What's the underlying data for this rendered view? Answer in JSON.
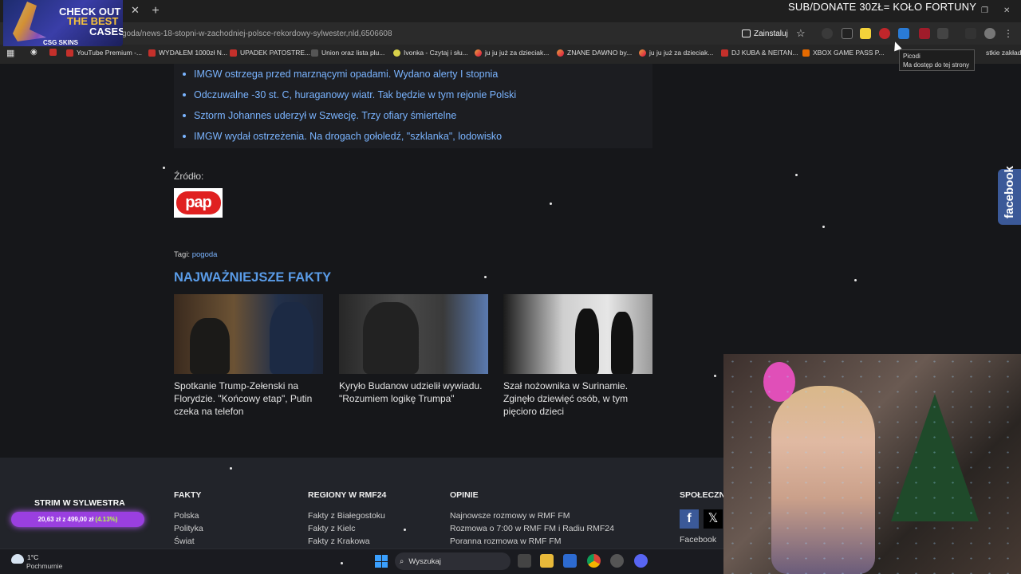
{
  "overlay": {
    "title": "SUB/DONATE 30ZŁ= KOŁO FORTUNY"
  },
  "ad": {
    "line1": "CHECK OUT",
    "line2": "THE BEST",
    "line3": "CASES",
    "brand": "CSG SKINS"
  },
  "browser": {
    "url": "goda/news-18-stopni-w-zachodniej-polsce-rekordowy-sylwester,nld,6506608",
    "install_label": "Zainstaluj",
    "bookmarks": [
      "YouTube Premium -...",
      "WYDAŁEM 1000zł N...",
      "UPADEK PATOSTRE...",
      "Union oraz lista plu...",
      "Ivonka - Czytaj i słu...",
      "ju ju już za dzieciak...",
      "ZNANE DAWNO by...",
      "ju ju już za dzieciak...",
      "DJ KUBA & NEITAN...",
      "XBOX GAME PASS P...",
      "stkie zakładki"
    ],
    "tooltip": {
      "title": "Picodi",
      "text": "Ma dostęp do tej strony"
    }
  },
  "article": {
    "related": [
      "IMGW ostrzega przed marznącymi opadami. Wydano alerty I stopnia",
      "Odczuwalne -30 st. C, huraganowy wiatr. Tak będzie w tym rejonie Polski",
      "Sztorm Johannes uderzył w Szwecję. Trzy ofiary śmiertelne",
      "IMGW wydał ostrzeżenia. Na drogach gołoledź, \"szklanka\", lodowisko"
    ],
    "source_label": "Źródło:",
    "source_logo": "pap",
    "tags_label": "Tagi:",
    "tag": "pogoda"
  },
  "facts": {
    "section_title": "NAJWAŻNIEJSZE FAKTY",
    "cards": [
      {
        "caption": "Spotkanie Trump-Zełenski na Florydzie. \"Końcowy etap\", Putin czeka na telefon"
      },
      {
        "caption": "Kyryło Budanow udzielił wywiadu. \"Rozumiem logikę Trumpa\""
      },
      {
        "caption": "Szał nożownika w Surinamie. Zginęło dziewięć osób, w tym pięcioro dzieci"
      }
    ]
  },
  "footer": {
    "fakty": {
      "title": "FAKTY",
      "links": [
        "Polska",
        "Polityka",
        "Świat"
      ]
    },
    "regiony": {
      "title": "REGIONY W RMF24",
      "links": [
        "Fakty z Białegostoku",
        "Fakty z Kielc",
        "Fakty z Krakowa"
      ]
    },
    "opinie": {
      "title": "OPINIE",
      "links": [
        "Najnowsze rozmowy w RMF FM",
        "Rozmowa o 7:00 w RMF FM i Radiu RMF24",
        "Poranna rozmowa w RMF FM"
      ]
    },
    "social": {
      "title": "SPOŁECZN",
      "fb_link": "Facebook"
    },
    "fb_side": "facebook"
  },
  "stream": {
    "title": "STRIM W SYLWESTRA",
    "progress_text": "20,63 zł z 499,00 zł",
    "progress_pct": "(4.13%)"
  },
  "taskbar": {
    "temp": "1°C",
    "weather": "Pochmurnie",
    "search_placeholder": "Wyszukaj"
  }
}
